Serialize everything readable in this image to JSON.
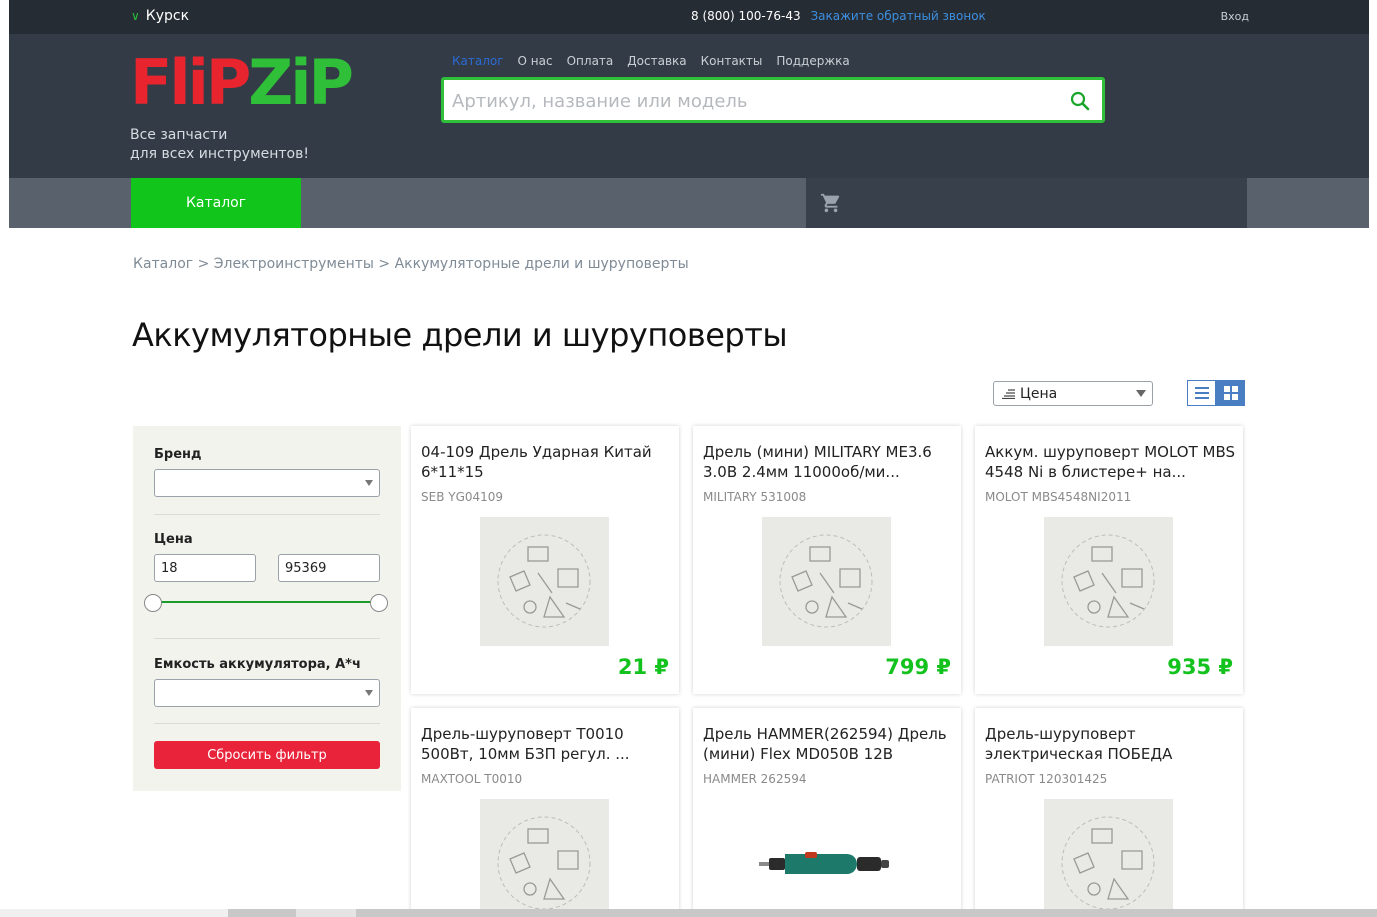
{
  "topbar": {
    "city": "Курск",
    "phone": "8 (800) 100-76-43",
    "callback": "Закажите обратный звонок",
    "login": "Вход"
  },
  "header": {
    "logo_part1": "FliP",
    "logo_part2": "ZiP",
    "tagline_line1": "Все запчасти",
    "tagline_line2": "для всех инструментов!",
    "nav": [
      "Каталог",
      "О нас",
      "Оплата",
      "Доставка",
      "Контакты",
      "Поддержка"
    ],
    "search_placeholder": "Артикул, название или модель"
  },
  "subnav": {
    "catalog_label": "Каталог"
  },
  "breadcrumb": "Каталог > Электроинструменты > Аккумуляторные дрели и шуруповерты",
  "page_title": "Аккумуляторные дрели и шуруповерты",
  "sort": {
    "selected": "Цена"
  },
  "filter": {
    "brand_label": "Бренд",
    "price_label": "Цена",
    "price_min": "18",
    "price_max": "95369",
    "capacity_label": "Емкость аккумулятора, А*ч",
    "reset_label": "Сбросить фильтр"
  },
  "products": [
    {
      "name": "04-109 Дрель Ударная Китай 6*11*15",
      "code": "SEB YG04109",
      "price": "21 ₽"
    },
    {
      "name": "Дрель (мини) MILITARY ME3.6 3.0В 2.4мм 11000об/ми...",
      "code": "MILITARY 531008",
      "price": "799 ₽"
    },
    {
      "name": "Аккум. шуруповерт MOLOT MBS 4548 Ni в блистере+ на...",
      "code": "MOLOT MBS4548NI2011",
      "price": "935 ₽"
    },
    {
      "name": "Дрель-шуруповерт T0010 500Вт, 10мм БЗП регул. ...",
      "code": "MAXTOOL T0010",
      "price": ""
    },
    {
      "name": "Дрель HAMMER(262594) Дрель (мини) Flex MD050B 12В",
      "code": "HAMMER 262594",
      "price": ""
    },
    {
      "name": "Дрель-шуруповерт электрическая ПОБЕДА",
      "code": "PATRIOT 120301425",
      "price": ""
    }
  ],
  "colors": {
    "accent_green": "#11c51b",
    "price_green": "#13c21d",
    "reset_red": "#e8233a",
    "header_bg": "#333c46"
  }
}
